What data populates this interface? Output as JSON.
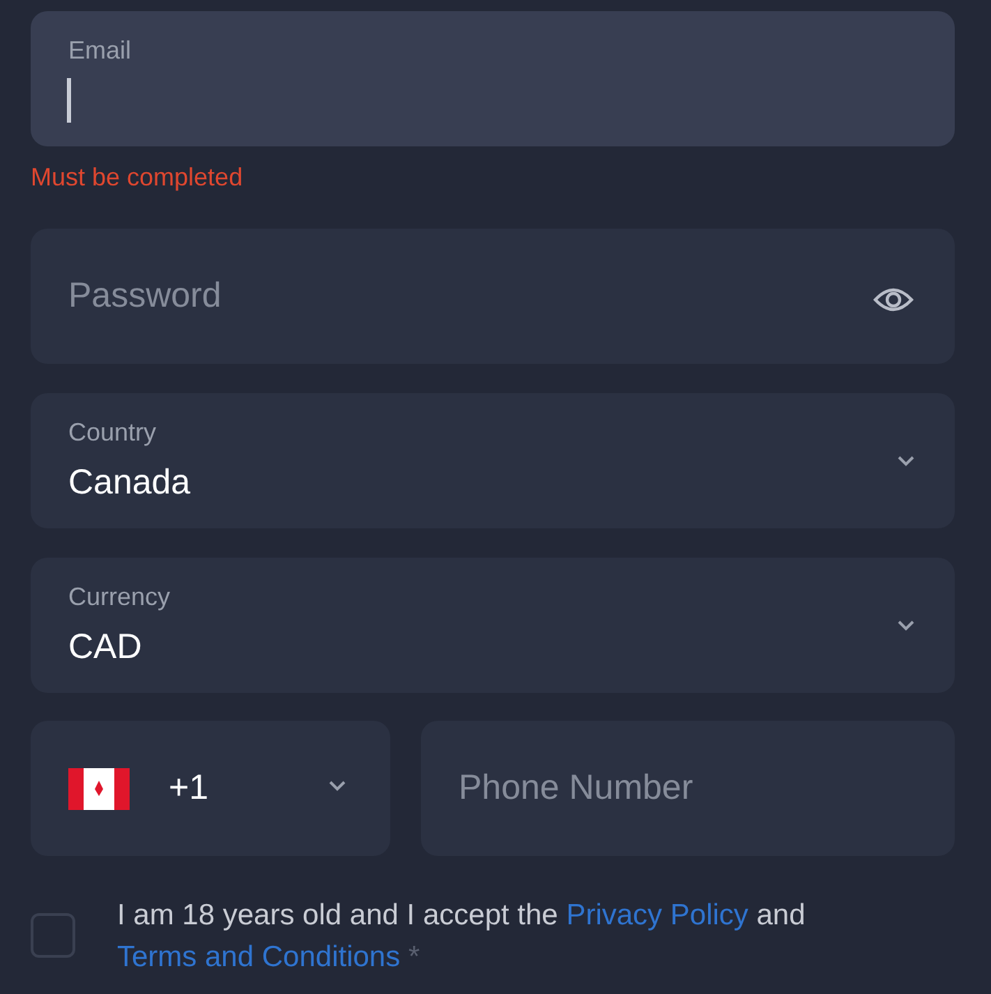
{
  "email": {
    "label": "Email",
    "focused": true
  },
  "email_error": "Must be completed",
  "password": {
    "placeholder": "Password"
  },
  "selects": [
    {
      "label": "Country",
      "value": "Canada"
    },
    {
      "label": "Currency",
      "value": "CAD"
    }
  ],
  "phone": {
    "code": "+1",
    "placeholder": "Phone Number"
  },
  "consent": {
    "checked": false,
    "parts": [
      {
        "kind": "text",
        "text": "I am 18 years old and I accept the"
      },
      {
        "kind": "link",
        "text": "Privacy Policy"
      },
      {
        "kind": "text",
        "text": "and"
      },
      {
        "kind": "link",
        "text": "Terms and Conditions"
      },
      {
        "kind": "required",
        "text": "*"
      }
    ]
  }
}
